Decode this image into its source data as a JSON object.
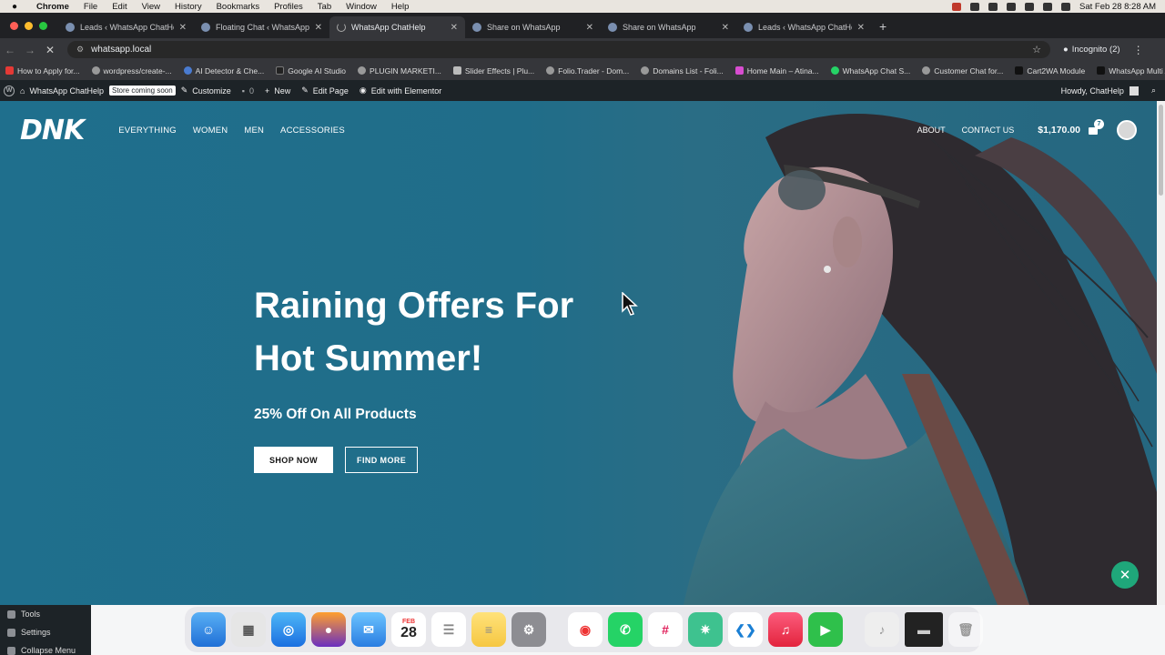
{
  "menubar": {
    "app": "Chrome",
    "items": [
      "File",
      "Edit",
      "View",
      "History",
      "Bookmarks",
      "Profiles",
      "Tab",
      "Window",
      "Help"
    ],
    "clock": "Sat Feb 28  8:28 AM"
  },
  "tabs": [
    {
      "title": "Leads ‹ WhatsApp ChatHelp",
      "active": false
    },
    {
      "title": "Floating Chat ‹ WhatsApp Ch",
      "active": false
    },
    {
      "title": "WhatsApp ChatHelp",
      "active": true
    },
    {
      "title": "Share on WhatsApp",
      "active": false
    },
    {
      "title": "Share on WhatsApp",
      "active": false
    },
    {
      "title": "Leads ‹ WhatsApp ChatHelp",
      "active": false
    }
  ],
  "address": {
    "url": "whatsapp.local",
    "profile": "Incognito (2)"
  },
  "bookmarks": [
    "How to Apply for...",
    "wordpress/create-...",
    "AI Detector & Che...",
    "Google AI Studio",
    "PLUGIN MARKETI...",
    "Slider Effects | Plu...",
    "Folio.Trader - Dom...",
    "Domains List - Foli...",
    "Home Main – Atina...",
    "WhatsApp Chat S...",
    "Customer Chat for...",
    "Cart2WA Module",
    "WhatsApp Multi A..."
  ],
  "wpbar": {
    "site": "WhatsApp ChatHelp",
    "badge": "Store coming soon",
    "customize": "Customize",
    "comments": "0",
    "new": "New",
    "edit_page": "Edit Page",
    "elementor": "Edit with Elementor",
    "howdy": "Howdy, ChatHelp"
  },
  "site": {
    "logo": "DNK",
    "nav_left": [
      "EVERYTHING",
      "WOMEN",
      "MEN",
      "ACCESSORIES"
    ],
    "nav_right": [
      "ABOUT",
      "CONTACT US"
    ],
    "cart_amount": "$1,170.00",
    "cart_count": "7"
  },
  "hero": {
    "title_line1": "Raining Offers For",
    "title_line2": "Hot Summer!",
    "subtitle": "25% Off On All Products",
    "btn_primary": "SHOP NOW",
    "btn_secondary": "FIND MORE"
  },
  "wp_side": {
    "tools": "Tools",
    "settings": "Settings",
    "collapse": "Collapse Menu"
  },
  "dock": {
    "calendar_month": "FEB",
    "calendar_day": "28",
    "apps": [
      "finder",
      "launchpad",
      "safari",
      "firefox",
      "mail",
      "calendar",
      "reminders",
      "notes",
      "system-settings",
      "chrome",
      "whatsapp",
      "slack",
      "chatgpt",
      "vscode",
      "music",
      "facetime",
      "audio-file",
      "screen-recording",
      "trash"
    ]
  },
  "colors": {
    "hero_bg": "#1f6f8d",
    "fab": "#1fa77a",
    "wp_admin": "#1d2327"
  }
}
